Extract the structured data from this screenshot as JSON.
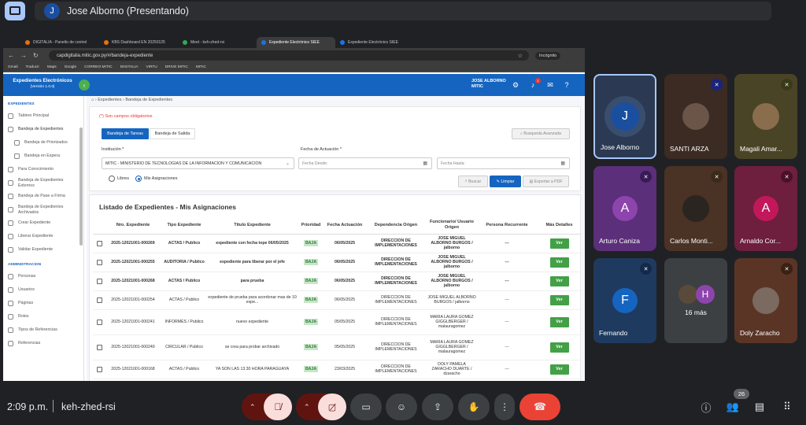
{
  "meet": {
    "presenter_bar": {
      "initial": "J",
      "title": "Jose Alborno (Presentando)"
    },
    "time": "2:09 p.m.",
    "meeting_code": "keh-zhed-rsi",
    "participants_count": "26",
    "more_label": "16 más",
    "colors": {
      "background": "#202124",
      "end_call": "#ea4335",
      "muted": "#f9dedc"
    }
  },
  "browser": {
    "tabs": [
      {
        "label": "DIGITALIA - Panelto de control"
      },
      {
        "label": "KBS Dashboard EN 20250125"
      },
      {
        "label": "Meet - keh-zhed-rsi"
      },
      {
        "label": "Expediente Electrónico SIEE"
      },
      {
        "label": "Expediente Electrónico SIEE"
      }
    ],
    "url": "capdigitalia.mitic.gov.py/#/bandeja-expediente",
    "profile": "Incógnito",
    "bookmarks": [
      "Gmail",
      "Traducir",
      "Maps",
      "Google",
      "CORREO MITIC",
      "DIGITALIA",
      "VIRTU",
      "DRIVE MITIC",
      "MITIC"
    ]
  },
  "app": {
    "brand_title": "Expedientes Electrónicos",
    "brand_version": "[Versión 1.0.0]",
    "user_name": "JOSE ALBORNO",
    "user_org": "MITIC",
    "notif_count": "1",
    "sidebar": {
      "section1": "EXPEDIENTES",
      "items1": [
        {
          "label": "Tablero Principal"
        },
        {
          "label": "Bandeja de Expedientes"
        },
        {
          "label": "Bandeja de Priorizados"
        },
        {
          "label": "Bandeja en Espera"
        },
        {
          "label": "Para Conocimiento"
        },
        {
          "label": "Bandeja de Expedientes Externos"
        },
        {
          "label": "Bandeja de Pase a Firma"
        },
        {
          "label": "Bandeja de Expedientes Archivados"
        },
        {
          "label": "Crear Expediente"
        },
        {
          "label": "Liberar Expediente"
        },
        {
          "label": "Validar Expediente"
        }
      ],
      "section2": "ADMINISTRACION",
      "items2": [
        {
          "label": "Personas"
        },
        {
          "label": "Usuarios"
        },
        {
          "label": "Páginas"
        },
        {
          "label": "Roles"
        },
        {
          "label": "Tipos de Referencias"
        },
        {
          "label": "Referencias"
        }
      ]
    },
    "breadcrumb": {
      "root": "Expedientes",
      "current": "Bandeja de Expedientes"
    },
    "form": {
      "required_note": "(*) Son campos obligatorios",
      "tab_tareas": "Bandeja de Tareas",
      "tab_salida": "Bandeja de Salida",
      "advanced_search": "Busqueda Avanzada",
      "institucion_label": "Institución *",
      "institucion_value": "MITIC - MINISTERIO DE TECNOLOGIAS DE LA INFORMACION Y COMUNICACION",
      "fecha_label": "Fecha de Actuación *",
      "fecha_desde": "Fecha Desde:",
      "fecha_hasta": "Fecha Hasta:",
      "radio_libres": "Libres",
      "radio_mis": "Mis Asignaciones",
      "btn_buscar": "Buscar",
      "btn_limpiar": "Limpiar",
      "btn_exportar": "Exportar a PDF"
    },
    "list": {
      "title": "Listado de Expedientes - Mis Asignaciones",
      "headers": [
        "Nro. Expediente",
        "Tipo Expediente",
        "Título Expediente",
        "Prioridad",
        "Fecha Actuación",
        "Dependencia Origen",
        "Funcionario/ Usuario Origen",
        "Persona Recurrente",
        "Más Detalles"
      ],
      "ver_label": "Ver",
      "rows": [
        {
          "nro": "2025-12021001-000269",
          "tipo": "ACTAS / Publico",
          "titulo": "expediente con fecha tope 06/05/2025",
          "prioridad": "BAJA",
          "fecha": "06/05/2025",
          "dep": "DIRECCION DE IMPLEMENTACIONES",
          "func": "JOSE MIGUEL ALBORNO BURGOS / jalborno",
          "persona": "---"
        },
        {
          "nro": "2025-12021001-000255",
          "tipo": "AUDITORIA / Publico",
          "titulo": "expediente para liberar por el jefe",
          "prioridad": "BAJA",
          "fecha": "06/05/2025",
          "dep": "DIRECCION DE IMPLEMENTACIONES",
          "func": "JOSE MIGUEL ALBORNO BURGOS / jalborno",
          "persona": "---"
        },
        {
          "nro": "2025-12021001-000268",
          "tipo": "ACTAS / Publico",
          "titulo": "para prueba",
          "prioridad": "BAJA",
          "fecha": "06/05/2025",
          "dep": "DIRECCION DE IMPLEMENTACIONES",
          "func": "JOSE MIGUEL ALBORNO BURGOS / jalborno",
          "persona": "---"
        },
        {
          "nro": "2025-12021001-000254",
          "tipo": "ACTAS / Publico",
          "titulo": "expediente de prueba para acordonar mas de 10 expe...",
          "prioridad": "BAJA",
          "fecha": "06/05/2025",
          "dep": "DIRECCION DE IMPLEMENTACIONES",
          "func": "JOSE MIGUEL ALBORNO BURGOS / jalborno",
          "persona": "---"
        },
        {
          "nro": "2025-12021001-000241",
          "tipo": "INFORMES / Publico",
          "titulo": "nuevo expediente",
          "prioridad": "BAJA",
          "fecha": "05/05/2025",
          "dep": "DIRECCION DE IMPLEMENTACIONES",
          "func": "MARIA LAURA GOMEZ GIGGLBERGER / malauragomez",
          "persona": "---"
        },
        {
          "nro": "2025-12021001-000240",
          "tipo": "CIRCULAR / Publico",
          "titulo": "se crea para probar archivado",
          "prioridad": "BAJA",
          "fecha": "05/05/2025",
          "dep": "DIRECCION DE IMPLEMENTACIONES",
          "func": "MARIA LAURA GOMEZ GIGGLBERGER / malauragomez",
          "persona": "---"
        },
        {
          "nro": "2025-12021001-000168",
          "tipo": "ACTAS / Publico",
          "titulo": "YA SON LAS 13.30 HORA PARAGUAYA",
          "prioridad": "BAJA",
          "fecha": "23/03/2025",
          "dep": "DIRECCION DE IMPLEMENTACIONES",
          "func": "DOLY PAMELA ZARACHO DUARTE / dzaracho",
          "persona": "---"
        }
      ]
    }
  },
  "participants": [
    {
      "name": "Jose Alborno",
      "initial": "J",
      "color": "#1a4fa0"
    },
    {
      "name": "SANTI ARZA"
    },
    {
      "name": "Magali Amar..."
    },
    {
      "name": "Arturo Caniza",
      "initial": "A",
      "color": "#8e44ad"
    },
    {
      "name": "Carlos Monti..."
    },
    {
      "name": "Arnaldo Cor...",
      "initial": "A",
      "color": "#c2185b"
    },
    {
      "name": "Fernando",
      "initial": "F",
      "color": "#1565c0"
    },
    {
      "initial": "H",
      "color": "#8e44ad"
    },
    {
      "name": "Doly Zaracho"
    }
  ]
}
